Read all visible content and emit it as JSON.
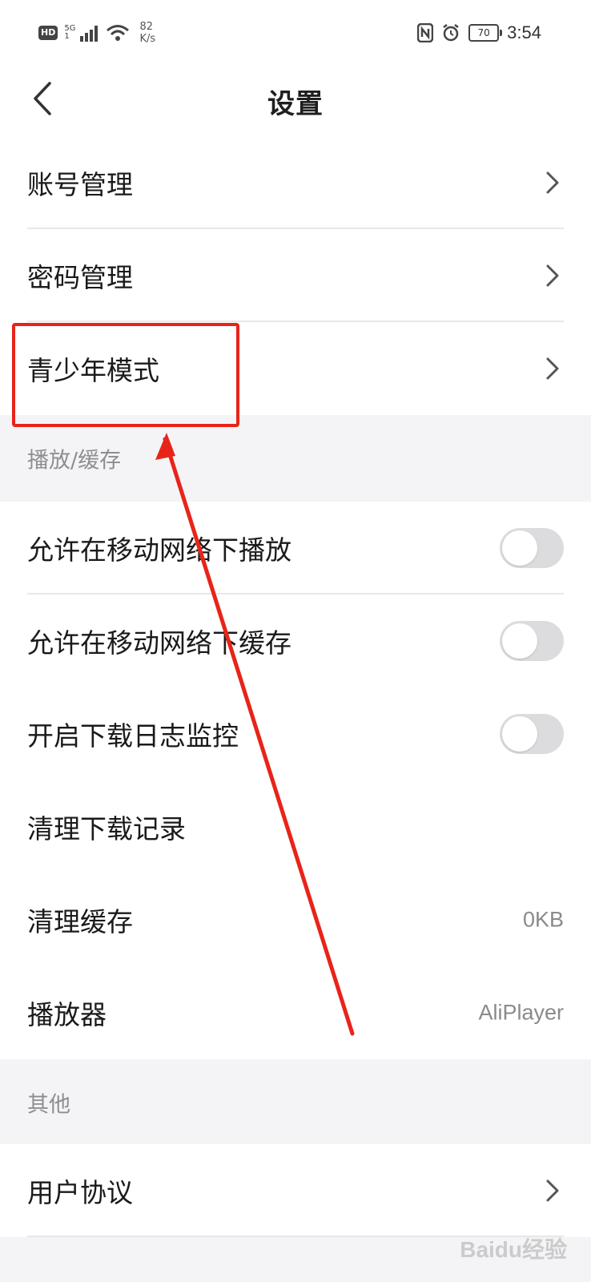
{
  "status_bar": {
    "hd": "HD",
    "network": "5G",
    "network_sub": "1",
    "speed_value": "82",
    "speed_unit": "K/s",
    "battery": "70",
    "time": "3:54"
  },
  "navbar": {
    "title": "设置"
  },
  "account_group": [
    {
      "label": "账号管理"
    },
    {
      "label": "密码管理"
    },
    {
      "label": "青少年模式"
    }
  ],
  "section_playback": {
    "title": "播放/缓存"
  },
  "playback_group": [
    {
      "label": "允许在移动网络下播放",
      "toggle": false
    },
    {
      "label": "允许在移动网络下缓存",
      "toggle": false
    },
    {
      "label": "开启下载日志监控",
      "toggle": false
    },
    {
      "label": "清理下载记录"
    },
    {
      "label": "清理缓存",
      "value": "0KB"
    },
    {
      "label": "播放器",
      "value": "AliPlayer"
    }
  ],
  "section_other": {
    "title": "其他"
  },
  "other_group": [
    {
      "label": "用户协议"
    }
  ],
  "watermark": "Baidu经验",
  "colors": {
    "highlight": "#e82419",
    "toggle_off": "#dcdcde",
    "background": "#f4f4f6"
  }
}
